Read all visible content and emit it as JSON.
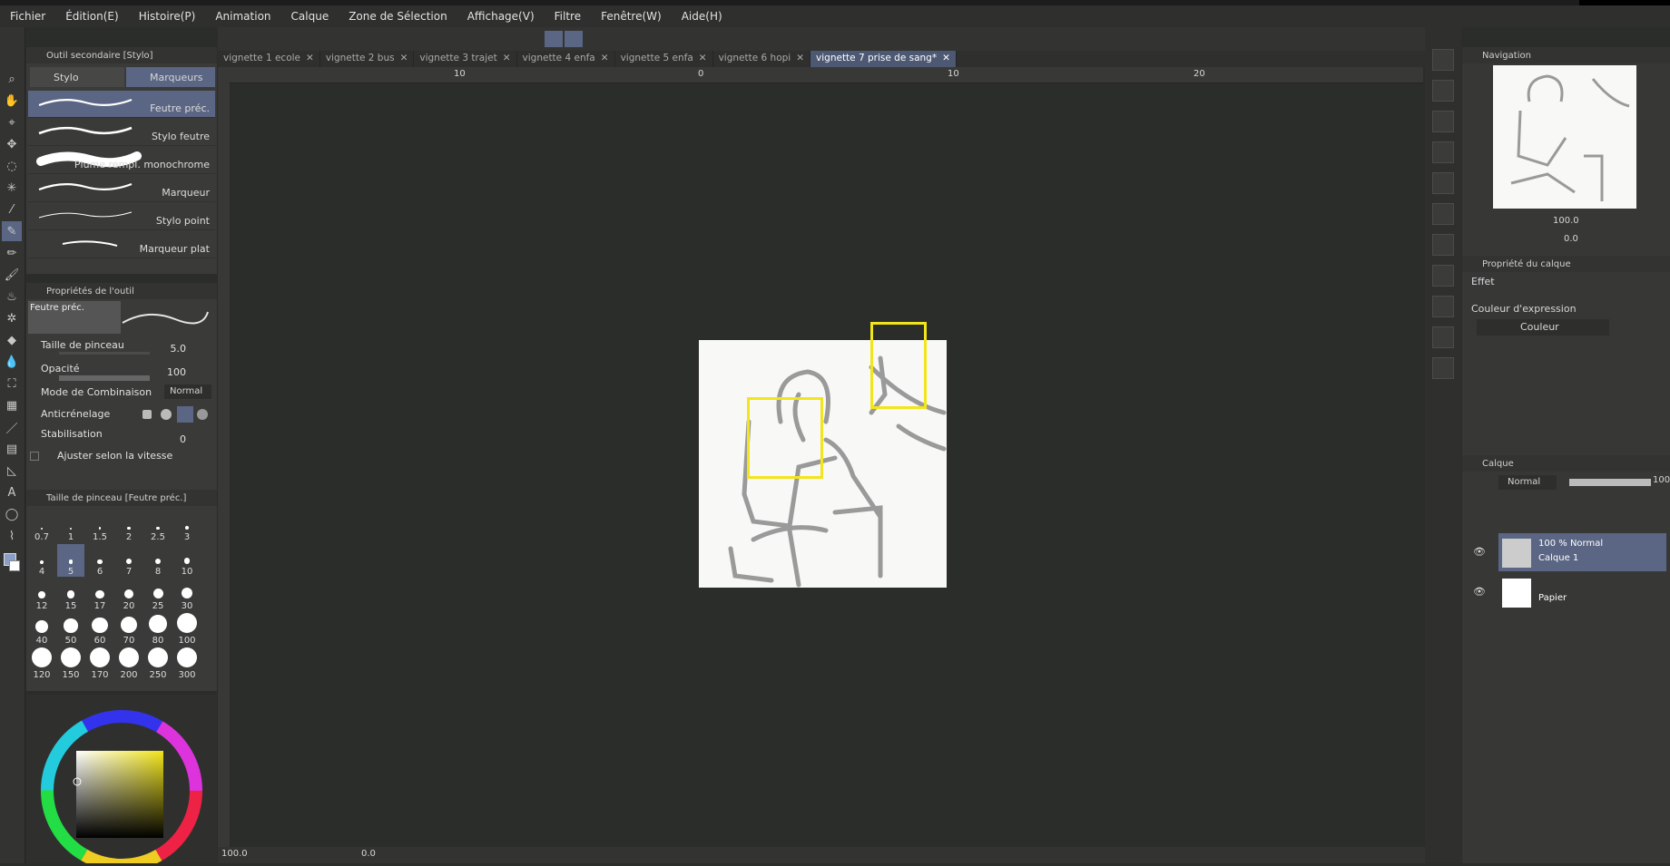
{
  "menu": [
    "Fichier",
    "Édition(E)",
    "Histoire(P)",
    "Animation",
    "Calque",
    "Zone de Sélection",
    "Affichage(V)",
    "Filtre",
    "Fenêtre(W)",
    "Aide(H)"
  ],
  "subtool_panel": {
    "title": "Outil secondaire [Stylo]",
    "tabs": [
      "Stylo",
      "Marqueurs"
    ],
    "brushes": [
      "Feutre préc.",
      "Stylo feutre",
      "Plume rempl. monochrome",
      "Marqueur",
      "Stylo point",
      "Marqueur plat"
    ]
  },
  "tool_props": {
    "title": "Propriétés de l'outil",
    "preview_label": "Feutre préc.",
    "brush_size_label": "Taille de pinceau",
    "brush_size_value": "5.0",
    "opacity_label": "Opacité",
    "opacity_value": "100",
    "blend_label": "Mode de Combinaison",
    "blend_value": "Normal",
    "antialias_label": "Anticrénelage",
    "stabilization_label": "Stabilisation",
    "stabilization_value": "0",
    "speed_label": "Ajuster selon la vitesse"
  },
  "brush_size": {
    "title": "Taille de pinceau [Feutre préc.]",
    "sizes": [
      "0.7",
      "1",
      "1.5",
      "2",
      "2.5",
      "3",
      "4",
      "5",
      "6",
      "7",
      "8",
      "10",
      "12",
      "15",
      "17",
      "20",
      "25",
      "30",
      "40",
      "50",
      "60",
      "70",
      "80",
      "100",
      "120",
      "150",
      "170",
      "200",
      "250",
      "300"
    ],
    "selected": "5"
  },
  "doc_tabs": [
    "vignette 1 ecole",
    "vignette 2 bus",
    "vignette 3 trajet",
    "vignette 4 enfa",
    "vignette 5 enfa",
    "vignette 6 hopi",
    "vignette 7 prise de sang*"
  ],
  "ruler_labels": [
    "10",
    "0",
    "10",
    "20"
  ],
  "status": {
    "zoom": "100.0",
    "angle": "0.0"
  },
  "navigator": {
    "title": "Navigation",
    "zoom": "100.0",
    "angle": "0.0"
  },
  "layer_prop": {
    "title": "Propriété du calque",
    "effect_label": "Effet",
    "expr_color_label": "Couleur d'expression",
    "expr_color_value": "Couleur"
  },
  "layers_panel": {
    "title": "Calque",
    "blend": "Normal",
    "opacity": "100",
    "layers": [
      {
        "line1": "100 % Normal",
        "line2": "Calque 1"
      },
      {
        "line1": "",
        "line2": "Papier"
      }
    ]
  },
  "colors": {
    "accent": "#5a6683",
    "highlight": "#f2e51b",
    "bg": "#2b2d2b"
  }
}
